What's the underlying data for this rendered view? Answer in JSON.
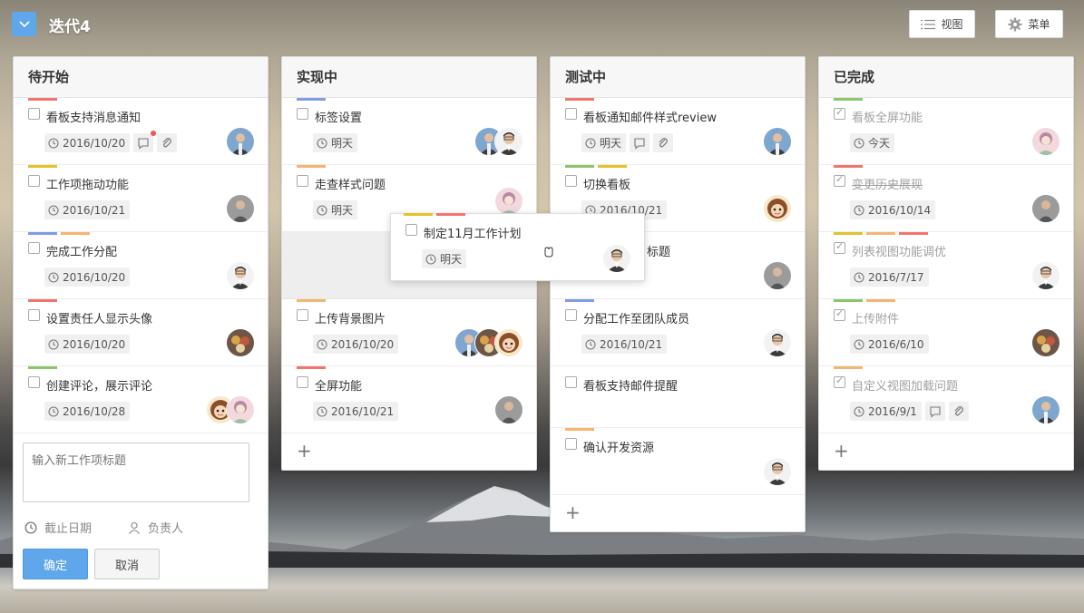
{
  "board": {
    "title": "迭代4"
  },
  "toolbar": {
    "view_label": "视图",
    "menu_label": "菜单"
  },
  "colors": {
    "accent": "#5fa7ea",
    "red": "#f0766c",
    "orange": "#f5b470",
    "yellow": "#e6c22a",
    "green": "#8dc56b",
    "blue": "#7e9de6"
  },
  "columns": [
    {
      "title": "待开始",
      "cards": [
        {
          "title": "看板支持消息通知",
          "date": "2016/10/20",
          "comment": true,
          "attach": true,
          "dot": true
        },
        {
          "title": "工作项拖动功能",
          "date": "2016/10/21"
        },
        {
          "title": "完成工作分配",
          "date": "2016/10/20"
        },
        {
          "title": "设置责任人显示头像",
          "date": "2016/10/20"
        },
        {
          "title": "创建评论，展示评论",
          "date": "2016/10/28"
        }
      ],
      "form": {
        "placeholder": "输入新工作项标题",
        "due_label": "截止日期",
        "owner_label": "负责人",
        "ok_label": "确定",
        "cancel_label": "取消"
      }
    },
    {
      "title": "实现中",
      "cards": [
        {
          "title": "标签设置",
          "date": "明天"
        },
        {
          "title": "走查样式问题",
          "date": "明天"
        },
        {
          "title": "上传背景图片",
          "date": "2016/10/20"
        },
        {
          "title": "全屏功能",
          "date": "2016/10/21"
        }
      ]
    },
    {
      "title": "测试中",
      "cards": [
        {
          "title": "看板通知邮件样式review",
          "date": "明天"
        },
        {
          "title": "切换看板",
          "date": "2016/10/21"
        },
        {
          "title": "标题"
        },
        {
          "title": "分配工作至团队成员",
          "date": "2016/10/21"
        },
        {
          "title": "看板支持邮件提醒"
        },
        {
          "title": "确认开发资源"
        }
      ]
    },
    {
      "title": "已完成",
      "cards": [
        {
          "title": "看板全屏功能",
          "date": "今天"
        },
        {
          "title": "变更历史展现",
          "date": "2016/10/14"
        },
        {
          "title": "列表视图功能调优",
          "date": "2016/7/17"
        },
        {
          "title": "上传附件",
          "date": "2016/6/10"
        },
        {
          "title": "自定义视图加载问题",
          "date": "2016/9/1"
        }
      ]
    }
  ],
  "dragging": {
    "title": "制定11月工作计划",
    "date": "明天"
  }
}
